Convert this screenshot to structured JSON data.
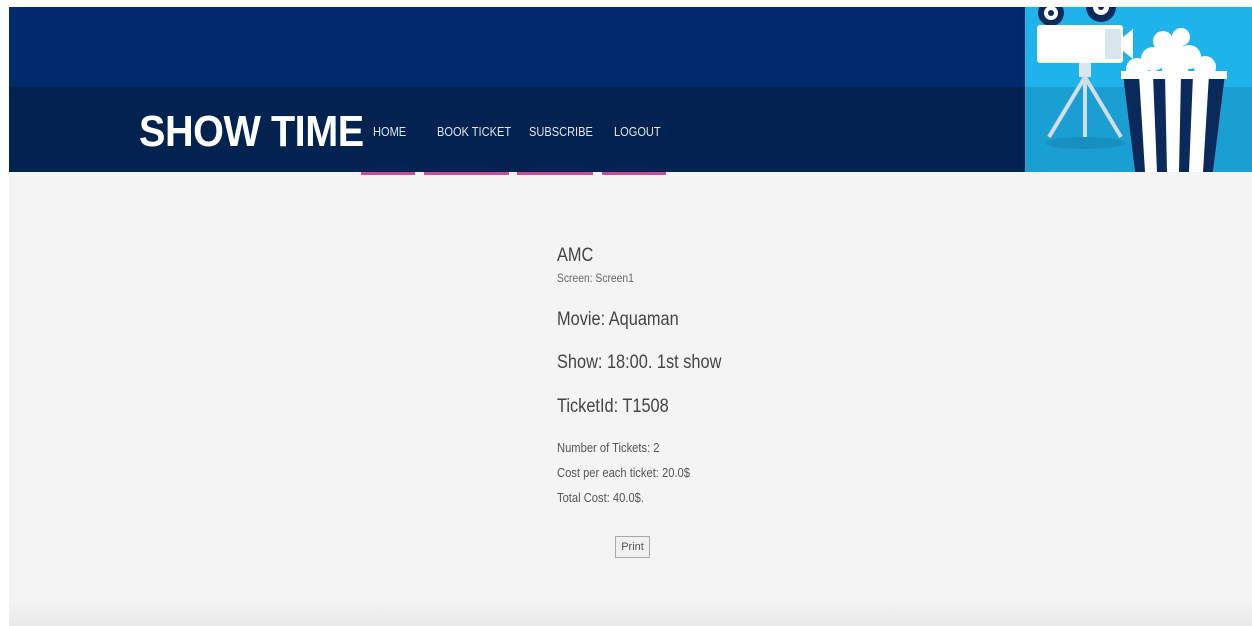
{
  "brand": {
    "logo_text": "SHOW TIME",
    "header_color": "#002a6c",
    "bar_color": "#02234f",
    "accent_color": "#c94f94",
    "hero_color": "#1fb3ec"
  },
  "nav": {
    "items": [
      {
        "label": "HOME"
      },
      {
        "label": "BOOK TICKET"
      },
      {
        "label": "SUBSCRIBE"
      },
      {
        "label": "LOGOUT"
      }
    ]
  },
  "ticket": {
    "cinema": "AMC",
    "screen": "Screen: Screen1",
    "movie": "Movie: Aquaman",
    "show": "Show: 18:00. 1st show",
    "ticket_id": "TicketId: T1508",
    "number_of_tickets": "Number of Tickets: 2",
    "cost_per_ticket": "Cost per each ticket: 20.0$",
    "total_cost": "Total Cost: 40.0$."
  },
  "actions": {
    "print_label": "Print"
  },
  "icons": {
    "hero": "movie-camera-popcorn-illustration"
  }
}
